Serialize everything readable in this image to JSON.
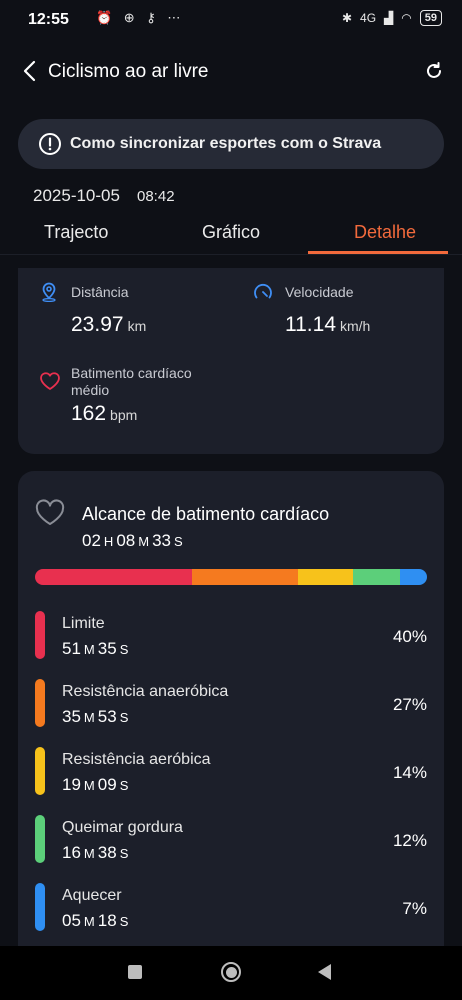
{
  "status_bar": {
    "time": "12:55",
    "left_icons": "⏰ ⊕ ⚷ ⋯",
    "signal": "4G",
    "battery": "59"
  },
  "header": {
    "title": "Ciclismo ao ar livre"
  },
  "banner": {
    "text": "Como sincronizar esportes com o Strava"
  },
  "session": {
    "date": "2025-10-05",
    "time": "08:42"
  },
  "tabs": [
    {
      "label": "Trajecto"
    },
    {
      "label": "Gráfico"
    },
    {
      "label": "Detalhe",
      "active": true
    }
  ],
  "stats": {
    "distance": {
      "label": "Distância",
      "value": "23.97",
      "unit": "km",
      "icon": "location-pin-icon"
    },
    "speed": {
      "label": "Velocidade",
      "value": "11.14",
      "unit": "km/h",
      "icon": "speedometer-icon"
    },
    "heart_rate": {
      "label_line1": "Batimento cardíaco",
      "label_line2": "médio",
      "value": "162",
      "unit": "bpm",
      "icon": "heart-icon"
    }
  },
  "hr_range": {
    "title": "Alcance de batimento cardíaco",
    "total": {
      "h": "02",
      "h_unit": "H",
      "m": "08",
      "m_unit": "M",
      "s": "33",
      "s_unit": "S"
    },
    "zones": [
      {
        "name": "Limite",
        "m": "51",
        "m_unit": "M",
        "s": "35",
        "s_unit": "S",
        "pct": "40%",
        "fraction": 0.4,
        "color": "#e8304f"
      },
      {
        "name": "Resistência anaeróbica",
        "m": "35",
        "m_unit": "M",
        "s": "53",
        "s_unit": "S",
        "pct": "27%",
        "fraction": 0.27,
        "color": "#f57a1f"
      },
      {
        "name": "Resistência aeróbica",
        "m": "19",
        "m_unit": "M",
        "s": "09",
        "s_unit": "S",
        "pct": "14%",
        "fraction": 0.14,
        "color": "#f7c21b"
      },
      {
        "name": "Queimar gordura",
        "m": "16",
        "m_unit": "M",
        "s": "38",
        "s_unit": "S",
        "pct": "12%",
        "fraction": 0.12,
        "color": "#5ccf7a"
      },
      {
        "name": "Aquecer",
        "m": "05",
        "m_unit": "M",
        "s": "18",
        "s_unit": "S",
        "pct": "7%",
        "fraction": 0.07,
        "color": "#2f8ff2"
      }
    ]
  }
}
